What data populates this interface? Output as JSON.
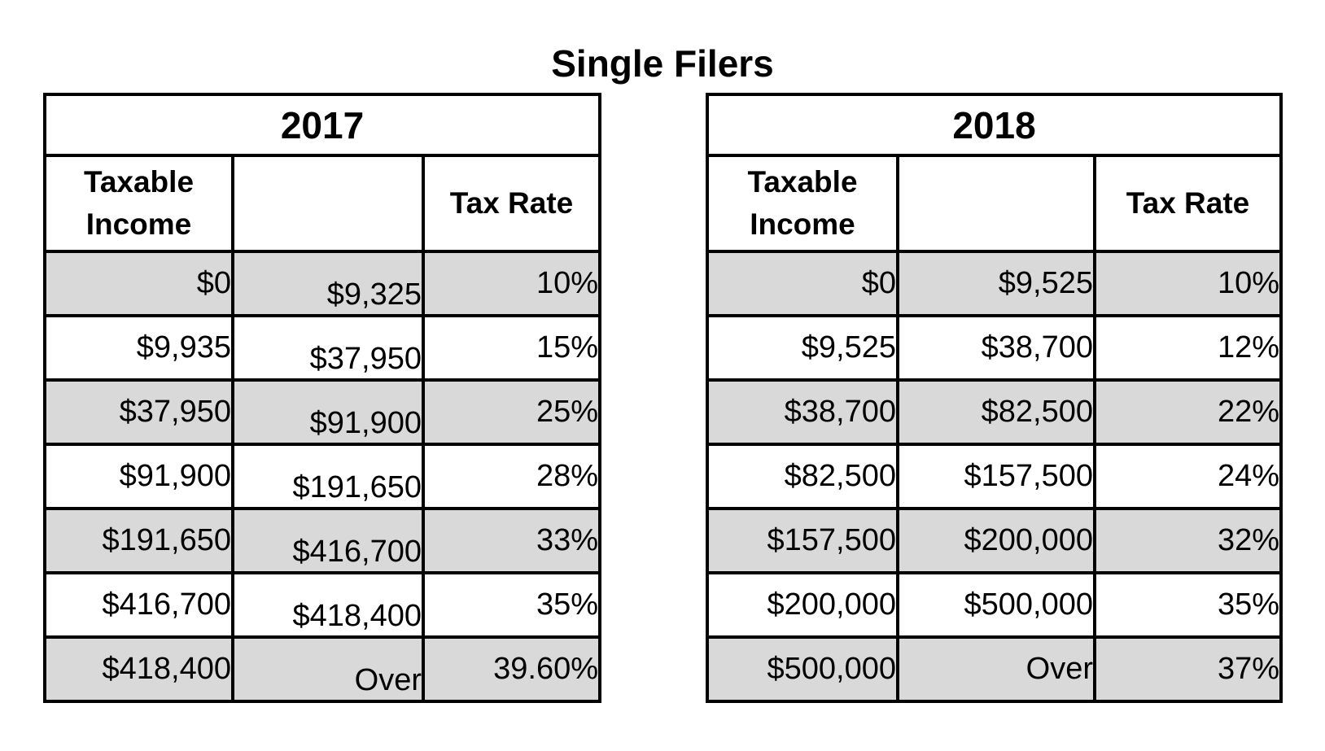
{
  "title": "Single Filers",
  "colors": {
    "shaded_row": "#d9d9d9",
    "border": "#000000"
  },
  "tables": [
    {
      "year": "2017",
      "headers": {
        "taxable_income": "Taxable Income",
        "upper": "",
        "tax_rate": "Tax Rate"
      },
      "rows": [
        {
          "from": "$0",
          "to": "$9,325",
          "rate": "10%"
        },
        {
          "from": "$9,935",
          "to": "$37,950",
          "rate": "15%"
        },
        {
          "from": "$37,950",
          "to": "$91,900",
          "rate": "25%"
        },
        {
          "from": "$91,900",
          "to": "$191,650",
          "rate": "28%"
        },
        {
          "from": "$191,650",
          "to": "$416,700",
          "rate": "33%"
        },
        {
          "from": "$416,700",
          "to": "$418,400",
          "rate": "35%"
        },
        {
          "from": "$418,400",
          "to": "Over",
          "rate": "39.60%"
        }
      ]
    },
    {
      "year": "2018",
      "headers": {
        "taxable_income": "Taxable Income",
        "upper": "",
        "tax_rate": "Tax Rate"
      },
      "rows": [
        {
          "from": "$0",
          "to": "$9,525",
          "rate": "10%"
        },
        {
          "from": "$9,525",
          "to": "$38,700",
          "rate": "12%"
        },
        {
          "from": "$38,700",
          "to": "$82,500",
          "rate": "22%"
        },
        {
          "from": "$82,500",
          "to": "$157,500",
          "rate": "24%"
        },
        {
          "from": "$157,500",
          "to": "$200,000",
          "rate": "32%"
        },
        {
          "from": "$200,000",
          "to": "$500,000",
          "rate": "35%"
        },
        {
          "from": "$500,000",
          "to": "Over",
          "rate": "37%"
        }
      ]
    }
  ]
}
